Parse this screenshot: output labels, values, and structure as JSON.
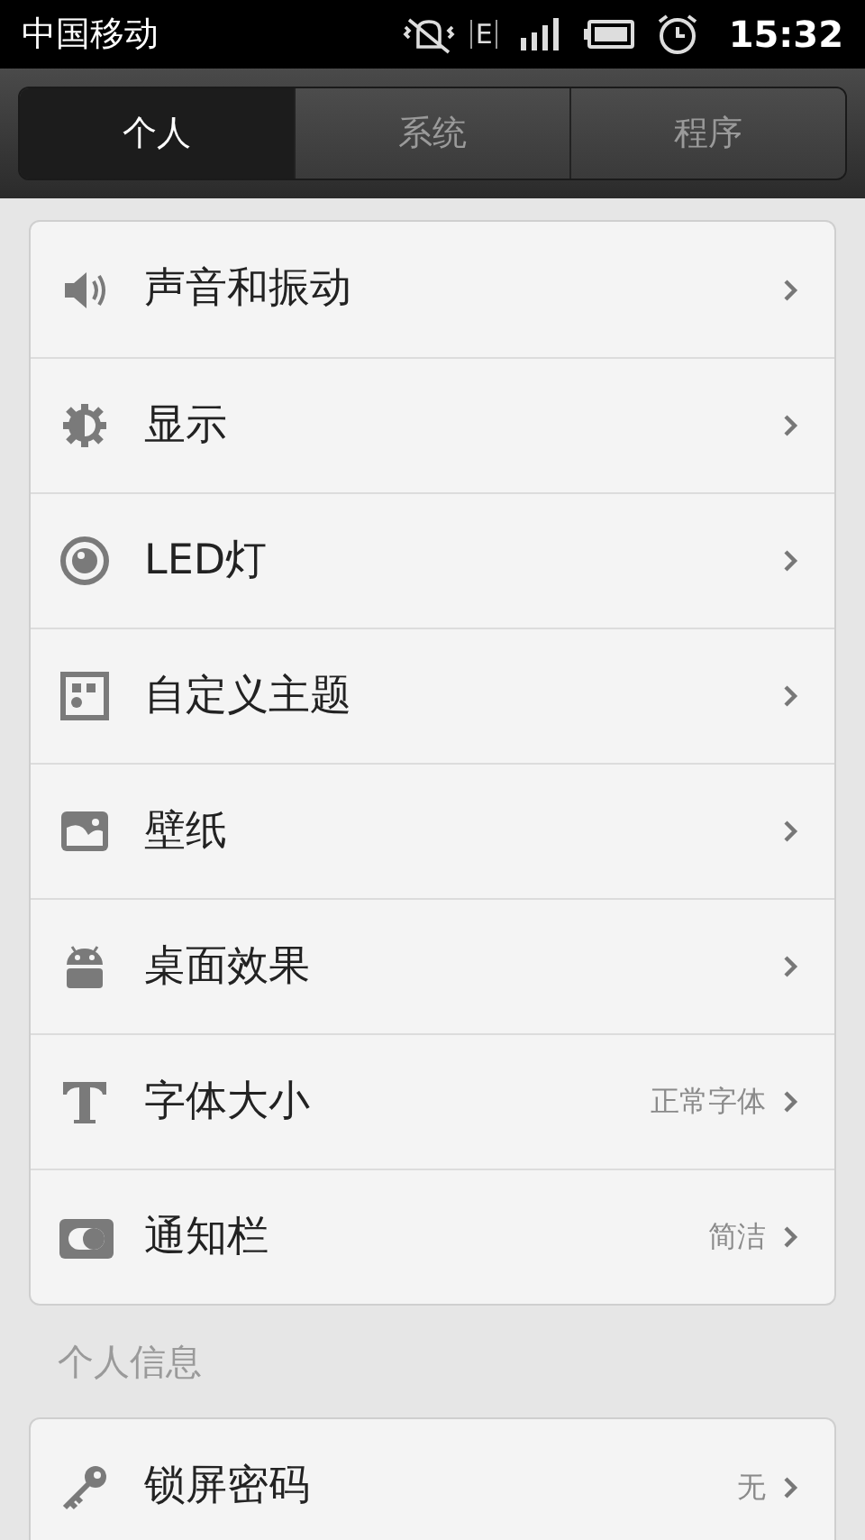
{
  "status_bar": {
    "carrier": "中国移动",
    "network": "E",
    "time": "15:32"
  },
  "tabs": [
    {
      "label": "个人",
      "selected": true
    },
    {
      "label": "系统",
      "selected": false
    },
    {
      "label": "程序",
      "selected": false
    }
  ],
  "groups": [
    {
      "items": [
        {
          "label": "声音和振动"
        },
        {
          "label": "显示"
        },
        {
          "label": "LED灯"
        },
        {
          "label": "自定义主题"
        },
        {
          "label": "壁纸"
        },
        {
          "label": "桌面效果"
        },
        {
          "label": "字体大小",
          "value": "正常字体"
        },
        {
          "label": "通知栏",
          "value": "简洁"
        }
      ]
    },
    {
      "header": "个人信息",
      "items": [
        {
          "label": "锁屏密码",
          "value": "无"
        }
      ]
    }
  ]
}
